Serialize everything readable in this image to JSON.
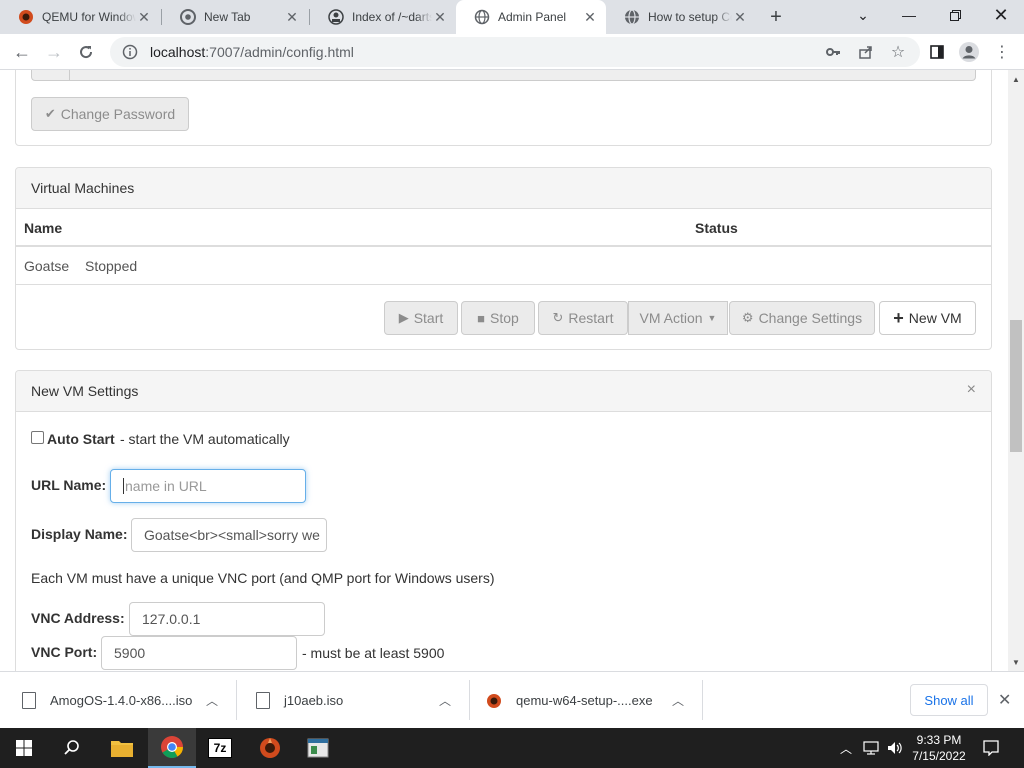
{
  "browser": {
    "tabs": [
      {
        "title": "QEMU for Windows",
        "favicon": "qemu-icon"
      },
      {
        "title": "New Tab",
        "favicon": "chrome-icon"
      },
      {
        "title": "Index of /~darts",
        "favicon": "index-icon"
      },
      {
        "title": "Admin Panel",
        "favicon": "globe-icon",
        "active": true
      },
      {
        "title": "How to setup Collab VM",
        "favicon": "globe-icon"
      }
    ],
    "url_host": "localhost",
    "url_rest": ":7007/admin/config.html"
  },
  "password_section": {
    "change_password_label": "Change Password"
  },
  "vm_panel": {
    "heading": "Virtual Machines",
    "columns": [
      "Name",
      "Status"
    ],
    "rows": [
      {
        "name": "Goatse",
        "status": "Stopped"
      }
    ],
    "buttons": {
      "start": "Start",
      "stop": "Stop",
      "restart": "Restart",
      "vm_action": "VM Action",
      "change_settings": "Change Settings",
      "new_vm": "New VM"
    }
  },
  "new_vm": {
    "heading": "New VM Settings",
    "close_glyph": "×",
    "auto_start_label": "Auto Start",
    "auto_start_desc": " - start the VM automatically",
    "url_name_label": "URL Name:",
    "url_name_placeholder": "name in URL",
    "display_name_label": "Display Name:",
    "display_name_value": "Goatse<br><small>sorry we",
    "vnc_note": "Each VM must have a unique VNC port (and QMP port for Windows users)",
    "vnc_address_label": "VNC Address:",
    "vnc_address_value": "127.0.0.1",
    "vnc_port_label": "VNC Port:",
    "vnc_port_value": "5900",
    "vnc_port_hint": "- must be at least 5900"
  },
  "downloads": {
    "items": [
      {
        "name": "AmogOS-1.4.0-x86....iso"
      },
      {
        "name": "j10aeb.iso"
      },
      {
        "name": "qemu-w64-setup-....exe"
      }
    ],
    "show_all": "Show all"
  },
  "taskbar": {
    "time": "9:33 PM",
    "date": "7/15/2022"
  },
  "colors": {
    "accent": "#1a73e8",
    "focus_border": "#66afe9",
    "panel_heading_bg": "#f5f5f5"
  }
}
